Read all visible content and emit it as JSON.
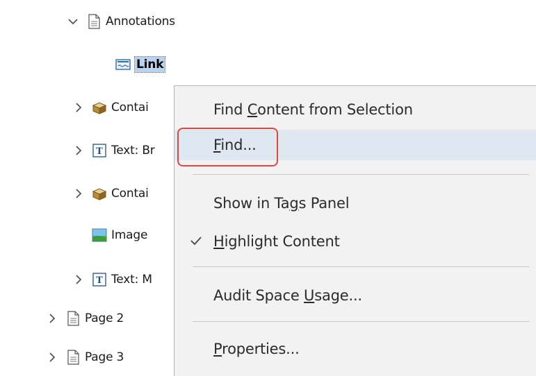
{
  "tree": {
    "items": [
      {
        "label": "Annotations",
        "icon": "page-icon",
        "expand": "expanded"
      },
      {
        "label": "Link",
        "icon": "link-icon",
        "selected": true
      },
      {
        "label": "Contai",
        "icon": "container-box-icon",
        "expand": "collapsed"
      },
      {
        "label": "Text: Br",
        "icon": "text-t-icon",
        "expand": "collapsed"
      },
      {
        "label": "Contai",
        "icon": "container-box-icon",
        "expand": "collapsed"
      },
      {
        "label": "Image",
        "icon": "image-icon"
      },
      {
        "label": "Text: M",
        "icon": "text-t-icon",
        "expand": "collapsed"
      },
      {
        "label": "Page 2",
        "icon": "page-icon",
        "expand": "collapsed"
      },
      {
        "label": "Page 3",
        "icon": "page-icon",
        "expand": "collapsed"
      }
    ]
  },
  "context_menu": {
    "items": [
      {
        "pre": "Find ",
        "accel": "C",
        "post": "ontent from Selection"
      },
      {
        "pre": "",
        "accel": "F",
        "post": "ind...",
        "highlighted": true
      },
      {
        "pre": "Show in Ta",
        "accel": "g",
        "post": "s Panel"
      },
      {
        "pre": "",
        "accel": "H",
        "post": "ighlight Content",
        "checked": true
      },
      {
        "pre": "Audit Space ",
        "accel": "U",
        "post": "sage..."
      },
      {
        "pre": "",
        "accel": "P",
        "post": "roperties..."
      }
    ]
  },
  "colors": {
    "menu_background": "#f2f2f2",
    "hover_background": "#dfe8f1",
    "focus_outline": "#e0453f",
    "selection_background": "#b9d3ee"
  }
}
